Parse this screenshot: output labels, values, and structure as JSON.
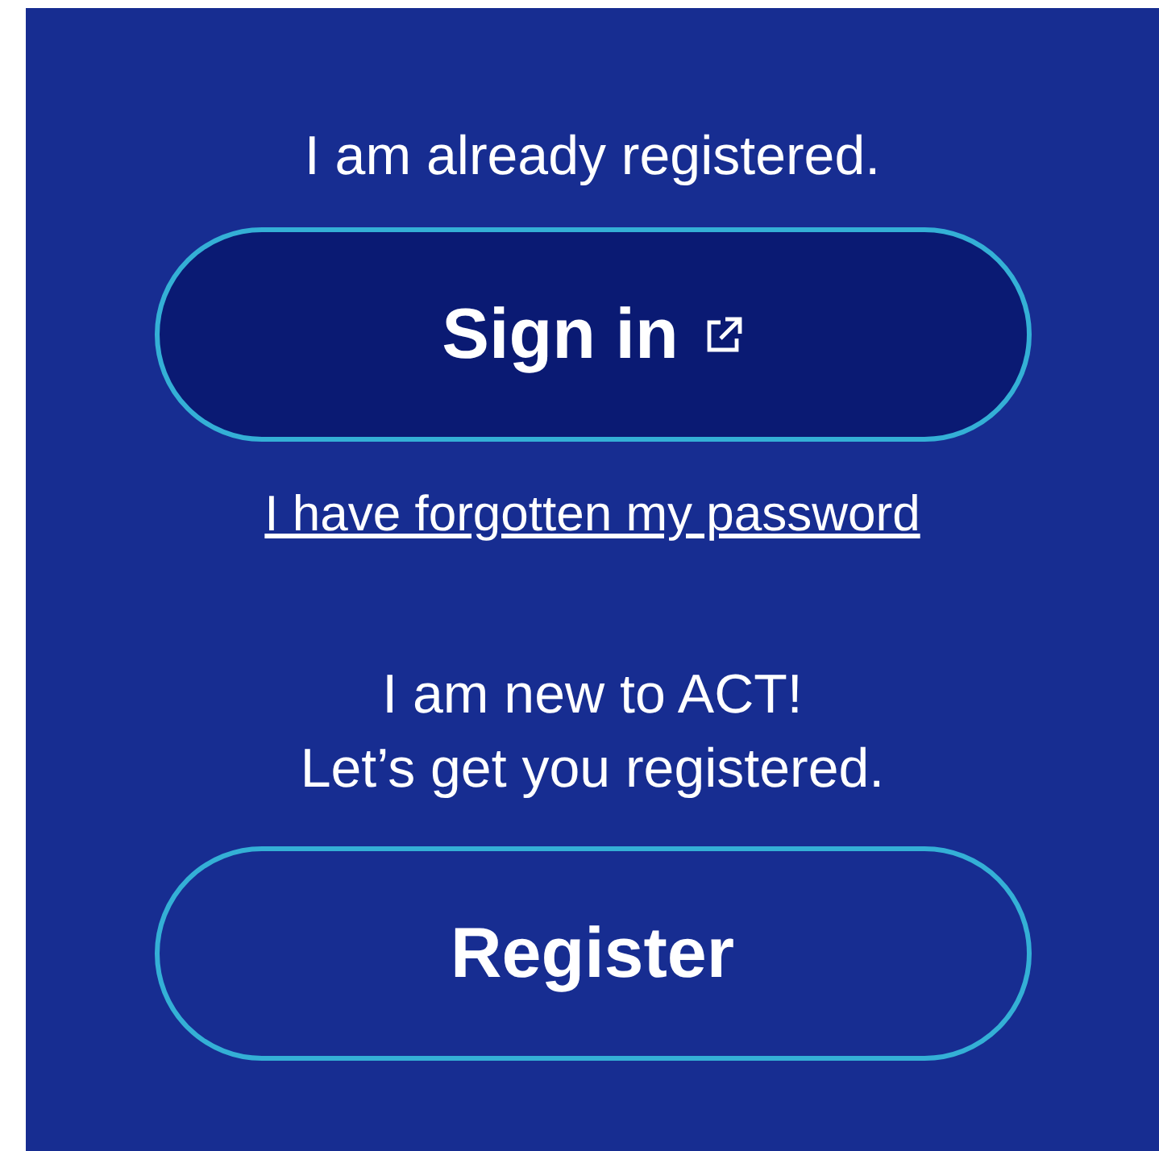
{
  "existing_user": {
    "prompt": "I am already registered."
  },
  "buttons": [
    {
      "kind": "primary",
      "label": "Sign in",
      "external": true
    },
    {
      "kind": "secondary",
      "label": "Register",
      "external": false
    }
  ],
  "forgot_password_link": "I have forgotten my password",
  "new_user": {
    "prompt_lines": [
      "I am new to ACT!",
      "Let’s get you registered."
    ]
  }
}
